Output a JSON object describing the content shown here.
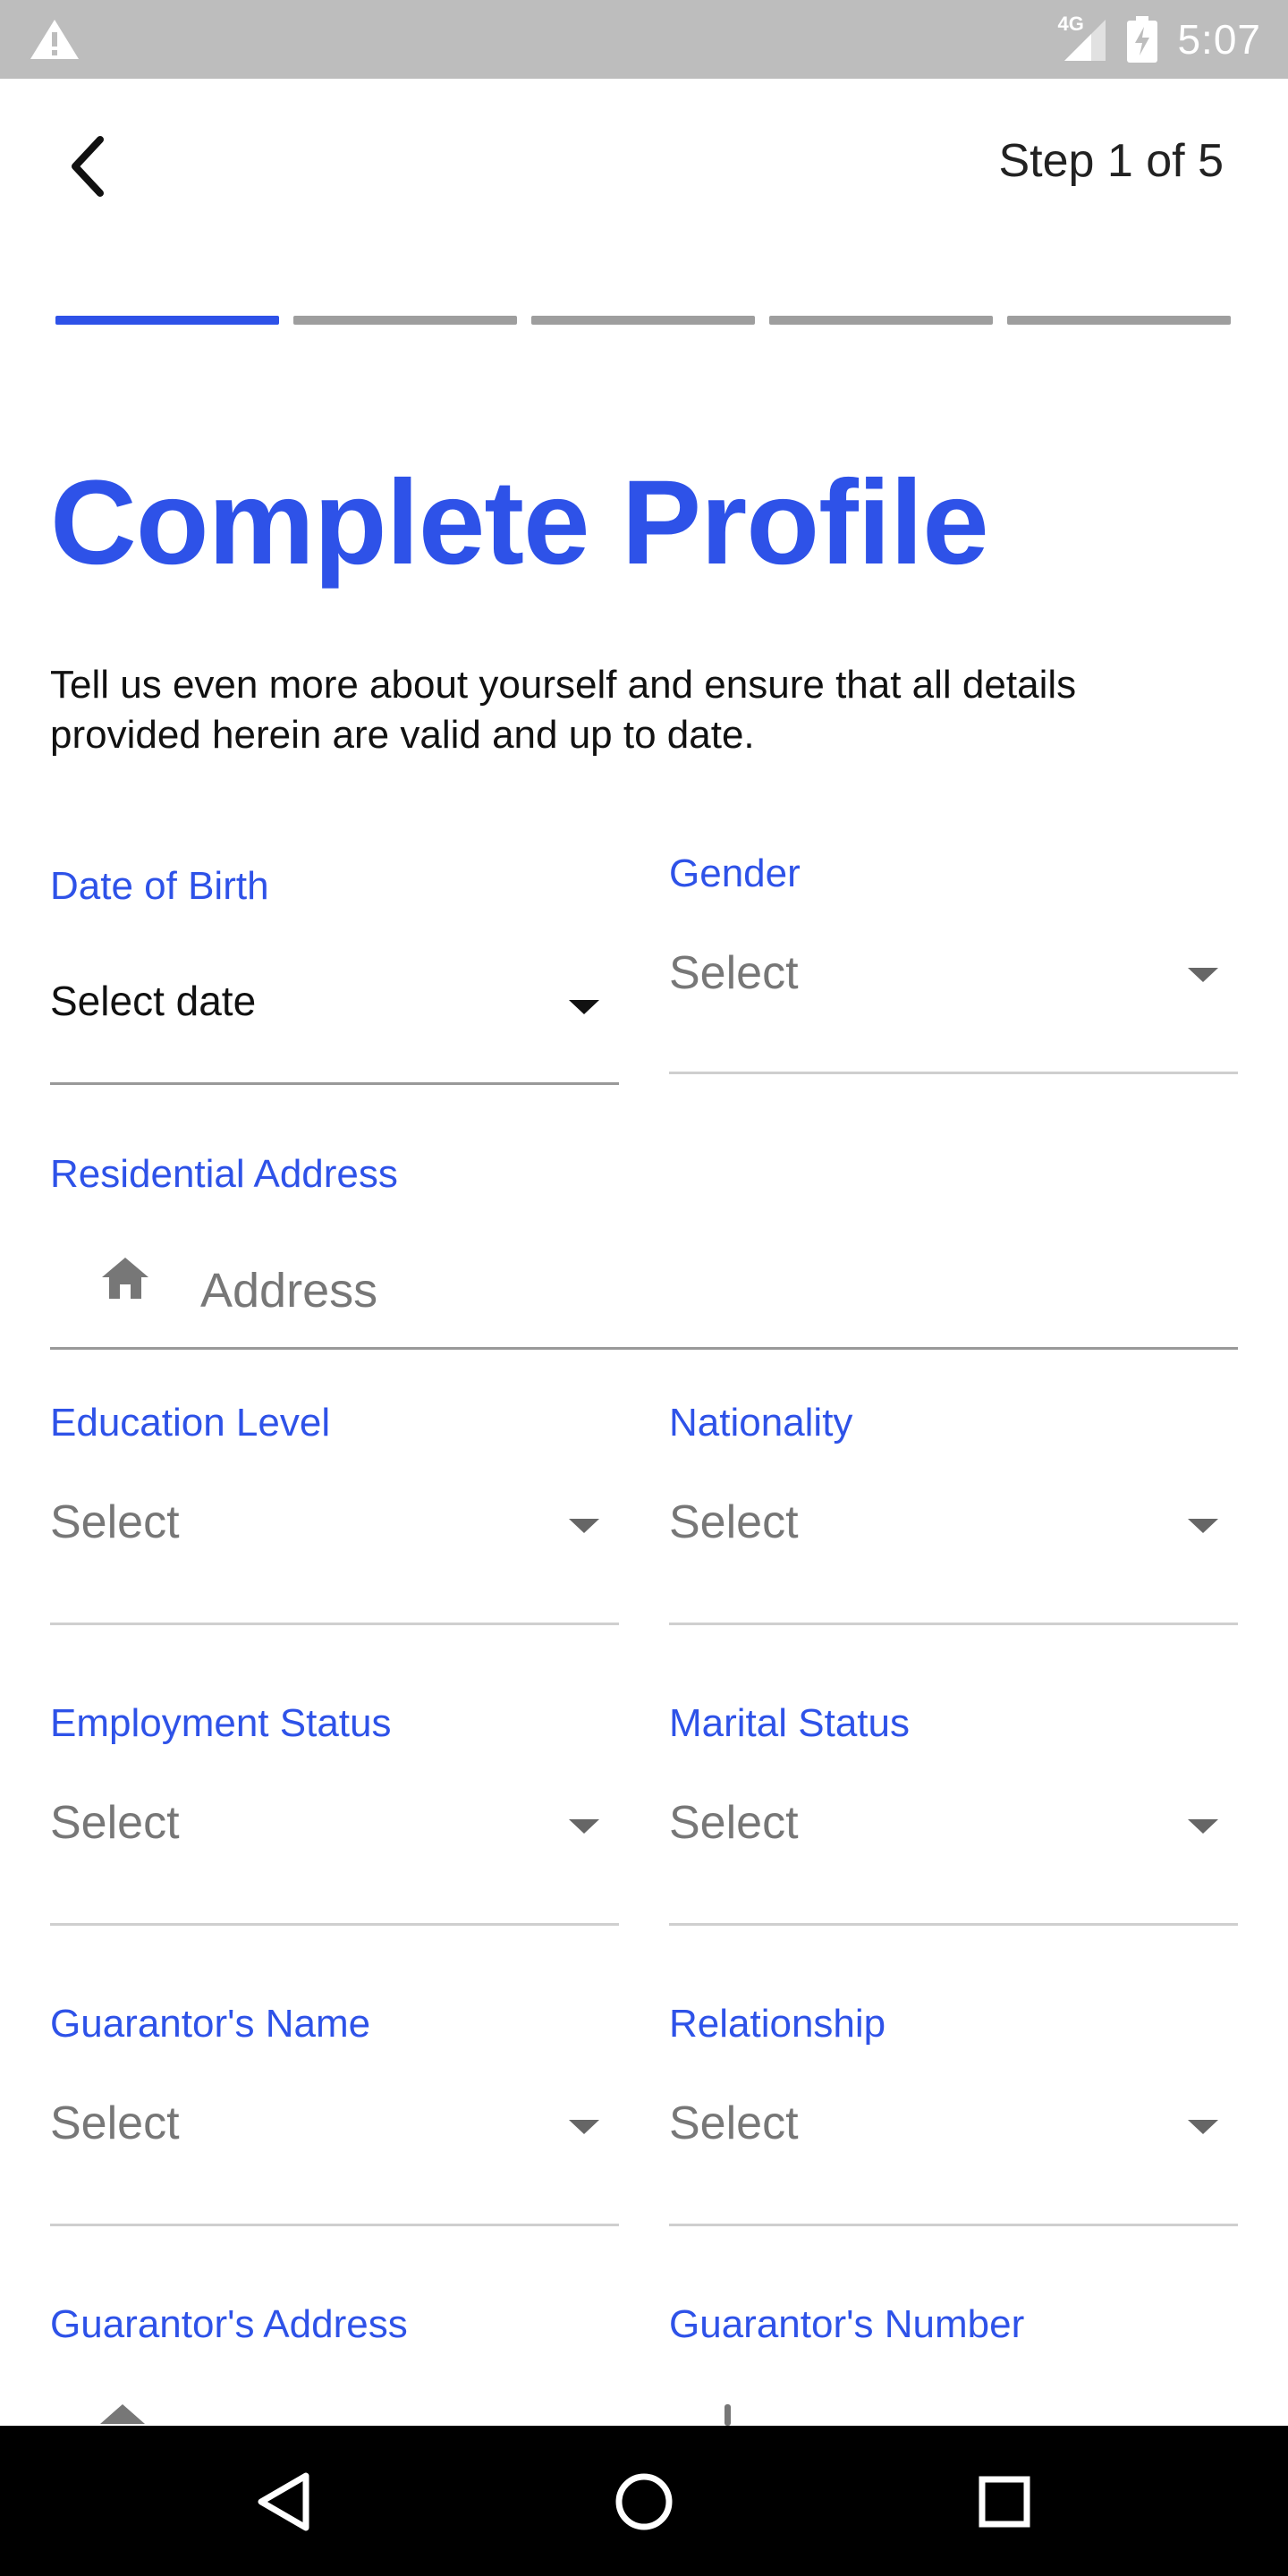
{
  "status_bar": {
    "time": "5:07",
    "network": "4G",
    "icons": [
      "warning-icon",
      "signal-icon",
      "battery-charging-icon"
    ]
  },
  "header": {
    "back_icon": "chevron-left-icon",
    "step_label": "Step 1 of 5"
  },
  "progress": {
    "current_step": 1,
    "total_steps": 5,
    "active_color": "#2e52e8",
    "inactive_color": "#9e9e9e"
  },
  "page": {
    "title": "Complete Profile",
    "subtitle": "Tell us even more about yourself and ensure that all details provided herein are valid and up to date."
  },
  "form": {
    "date_of_birth": {
      "label": "Date of Birth",
      "value": "Select date"
    },
    "gender": {
      "label": "Gender",
      "value": "Select"
    },
    "residential_address": {
      "label": "Residential Address",
      "placeholder": "Address",
      "icon": "home-icon"
    },
    "education_level": {
      "label": "Education Level",
      "value": "Select"
    },
    "nationality": {
      "label": "Nationality",
      "value": "Select"
    },
    "employment_status": {
      "label": "Employment Status",
      "value": "Select"
    },
    "marital_status": {
      "label": "Marital Status",
      "value": "Select"
    },
    "guarantors_name": {
      "label": "Guarantor's Name",
      "value": "Select"
    },
    "relationship": {
      "label": "Relationship",
      "value": "Select"
    },
    "guarantors_address": {
      "label": "Guarantor's Address"
    },
    "guarantors_number": {
      "label": "Guarantor's Number"
    }
  },
  "nav": {
    "buttons": [
      "back-triangle-icon",
      "home-circle-icon",
      "recents-square-icon"
    ]
  },
  "colors": {
    "accent": "#2e52e8",
    "status_bar": "#bdbdbd",
    "nav_bar": "#000000"
  }
}
